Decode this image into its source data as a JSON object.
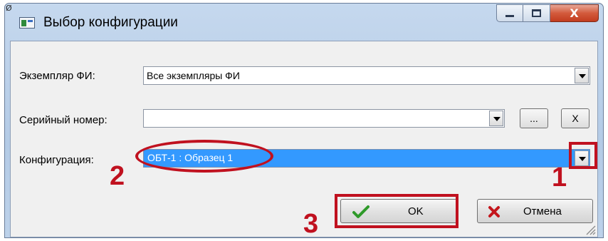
{
  "window": {
    "corner_mark": "Ø",
    "title": "Выбор конфигурации"
  },
  "controls": {
    "min_icon": "minimize-icon",
    "max_icon": "maximize-icon",
    "close_label": "X"
  },
  "form": {
    "instance_label": "Экземпляр ФИ:",
    "instance_value": "Все экземпляры ФИ",
    "serial_label": "Серийный номер:",
    "serial_value": "",
    "browse_label": "...",
    "clear_label": "X",
    "config_label": "Конфигурация:",
    "config_value": "ОБТ-1 : Образец 1"
  },
  "buttons": {
    "ok_label": "OK",
    "cancel_label": "Отмена"
  },
  "annotations": {
    "step1": "1",
    "step2": "2",
    "step3": "3",
    "color": "#c0111f"
  }
}
